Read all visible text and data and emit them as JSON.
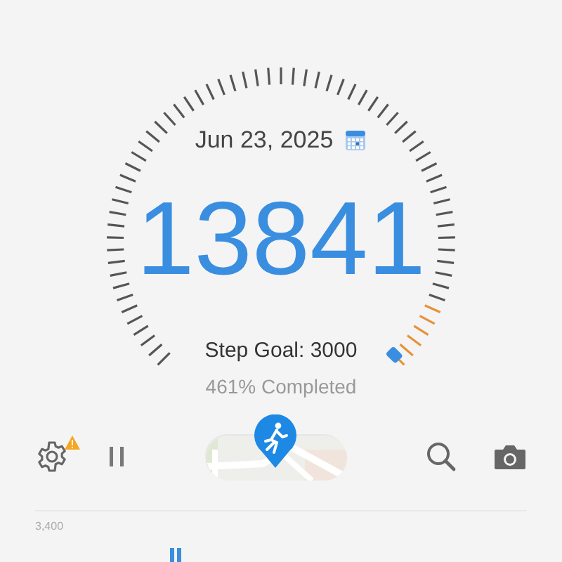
{
  "date": "Jun 23, 2025",
  "steps": "13841",
  "step_goal": "Step Goal: 3000",
  "completion": "461% Completed",
  "toolbar": {
    "settings_alert": true
  },
  "chart": {
    "axis_label": "3,400"
  }
}
